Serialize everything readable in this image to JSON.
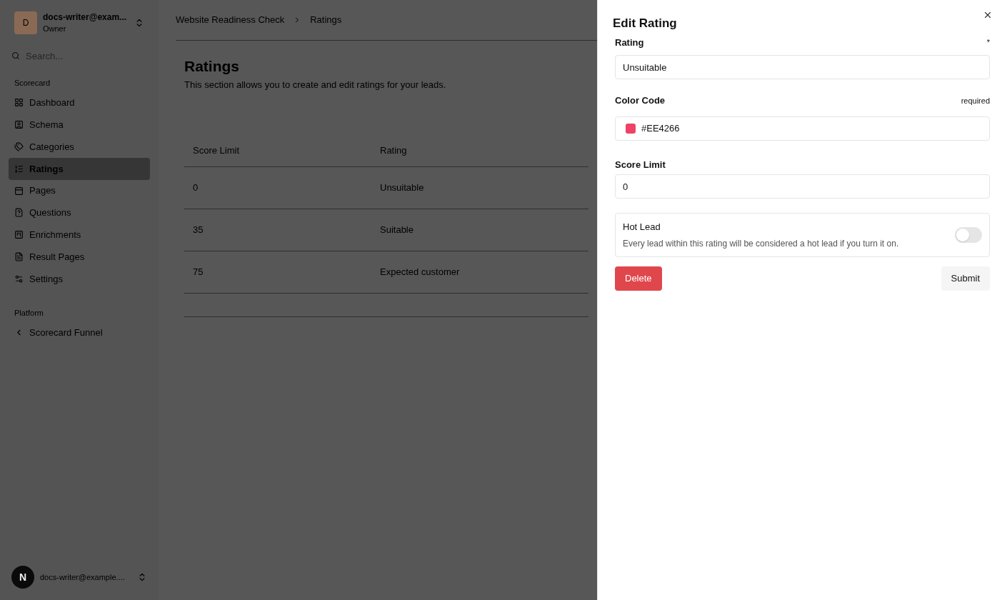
{
  "account": {
    "initial": "D",
    "email": "docs-writer@exam...",
    "role": "Owner"
  },
  "search": {
    "placeholder": "Search..."
  },
  "sidebar": {
    "sections": [
      {
        "title": "Scorecard",
        "items": [
          {
            "label": "Dashboard",
            "selected": false
          },
          {
            "label": "Schema",
            "selected": false
          },
          {
            "label": "Categories",
            "selected": false
          },
          {
            "label": "Ratings",
            "selected": true
          },
          {
            "label": "Pages",
            "selected": false
          },
          {
            "label": "Questions",
            "selected": false
          },
          {
            "label": "Enrichments",
            "selected": false
          },
          {
            "label": "Result Pages",
            "selected": false
          },
          {
            "label": "Settings",
            "selected": false
          }
        ]
      },
      {
        "title": "Platform",
        "items": [
          {
            "label": "Scorecard Funnel",
            "selected": false
          }
        ]
      }
    ]
  },
  "user": {
    "initial": "N",
    "email": "docs-writer@example...."
  },
  "breadcrumb": [
    "Website Readiness Check",
    "Ratings"
  ],
  "page": {
    "title": "Ratings",
    "description": "This section allows you to create and edit ratings for your leads."
  },
  "table": {
    "columns": [
      "Score Limit",
      "Rating"
    ],
    "rows": [
      [
        "0",
        "Unsuitable"
      ],
      [
        "35",
        "Suitable"
      ],
      [
        "75",
        "Expected customer"
      ]
    ]
  },
  "sheet": {
    "title": "Edit Rating",
    "rating": {
      "label": "Rating",
      "marker": "*",
      "value": "Unsuitable"
    },
    "color_code": {
      "label": "Color Code",
      "hint": "required",
      "value": "#EE4266",
      "color": "#ee4266"
    },
    "score_limit": {
      "label": "Score Limit",
      "value": "0"
    },
    "hot_lead": {
      "title": "Hot Lead",
      "description": "Every lead within this rating will be considered a hot lead if you turn it on.",
      "on": false
    },
    "buttons": {
      "delete": "Delete",
      "submit": "Submit"
    }
  }
}
